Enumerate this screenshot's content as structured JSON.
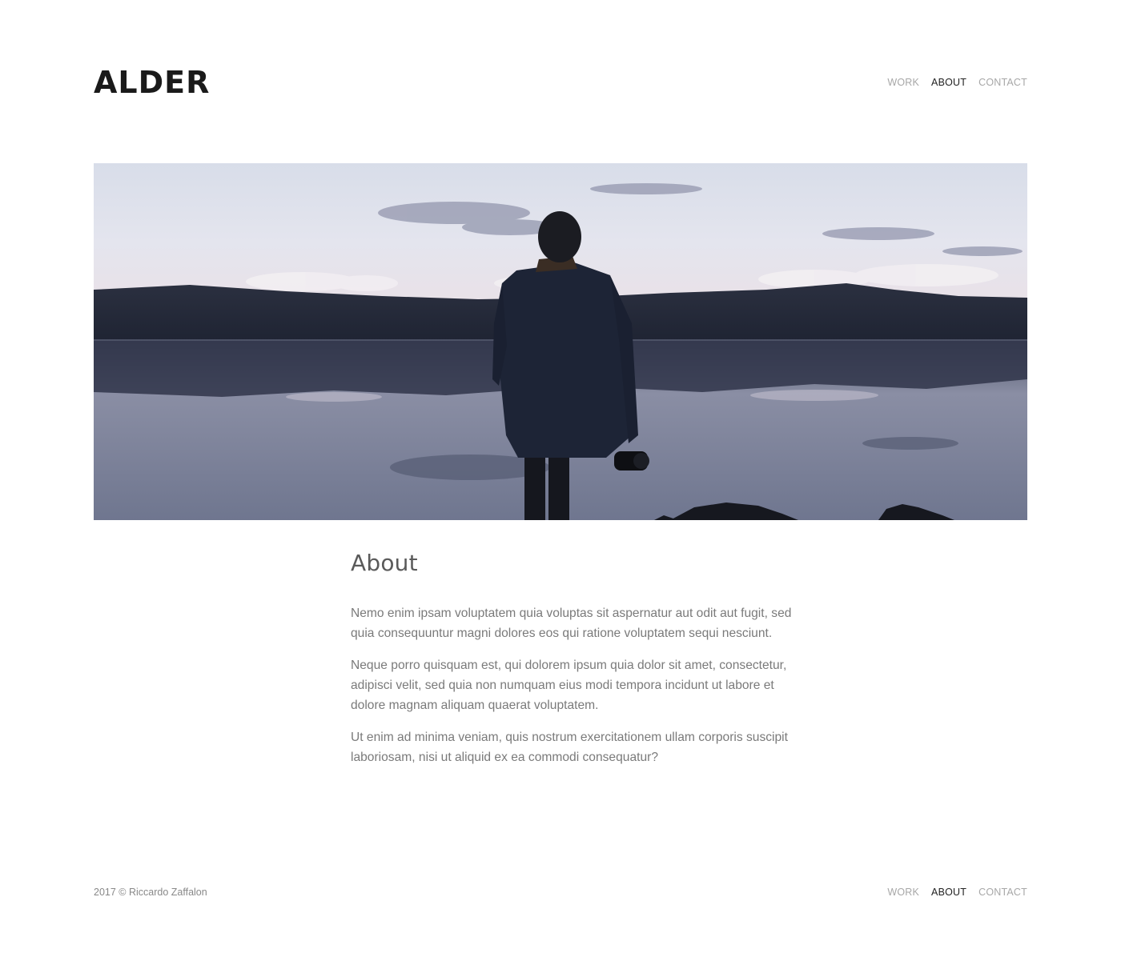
{
  "header": {
    "logo": "ALDER",
    "nav": [
      {
        "label": "WORK",
        "active": false
      },
      {
        "label": "ABOUT",
        "active": true
      },
      {
        "label": "CONTACT",
        "active": false
      }
    ]
  },
  "main": {
    "title": "About",
    "paragraphs": [
      "Nemo enim ipsam voluptatem quia voluptas sit aspernatur aut odit aut fugit, sed quia consequuntur magni dolores eos qui ratione voluptatem sequi nesciunt.",
      "Neque porro quisquam est, qui dolorem ipsum quia dolor sit amet, consectetur, adipisci velit, sed quia non numquam eius modi tempora incidunt ut labore et dolore magnam aliquam quaerat voluptatem.",
      "Ut enim ad minima veniam, quis nostrum exercitationem ullam corporis suscipit laboriosam, nisi ut aliquid ex ea commodi consequatur?"
    ]
  },
  "footer": {
    "copyright": "2017 © Riccardo Zaffalon",
    "nav": [
      {
        "label": "WORK",
        "active": false
      },
      {
        "label": "ABOUT",
        "active": true
      },
      {
        "label": "CONTACT",
        "active": false
      }
    ]
  },
  "colors": {
    "text_dark": "#1a1a1a",
    "nav_inactive": "#a7a7a7",
    "nav_active": "#222222",
    "body_text": "#7a7a7a"
  }
}
